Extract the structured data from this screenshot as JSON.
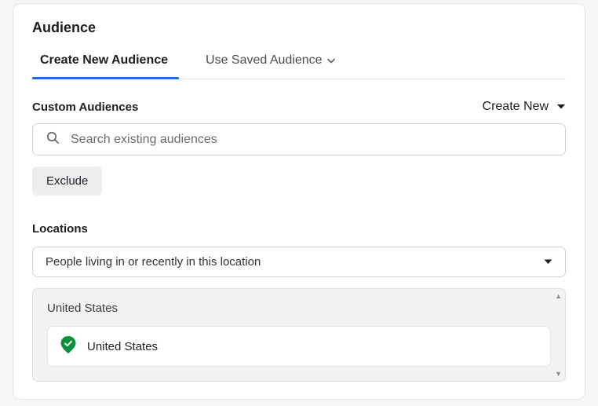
{
  "title": "Audience",
  "tabs": {
    "create": "Create New Audience",
    "saved": "Use Saved Audience"
  },
  "customAudiences": {
    "label": "Custom Audiences",
    "createNew": "Create New",
    "searchPlaceholder": "Search existing audiences",
    "excludeBtn": "Exclude"
  },
  "locations": {
    "label": "Locations",
    "selector": "People living in or recently in this location",
    "panelHeading": "United States",
    "chipText": "United States"
  }
}
